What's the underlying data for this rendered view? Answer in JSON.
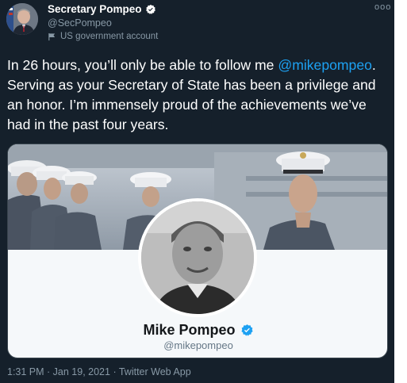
{
  "author": {
    "display_name": "Secretary Pompeo",
    "handle": "@SecPompeo",
    "label": "US government account",
    "verified": true,
    "avatar_icon": "portrait-avatar"
  },
  "menu": {
    "more_label": "ooo"
  },
  "tweet": {
    "text_before": "In 26 hours, you’ll only be able to follow me ",
    "mention": "@mikepompeo",
    "text_after": ". Serving as your Secretary of State has been a privilege and an honor. I’m immensely proud of the achievements we’ve had in the past four years."
  },
  "profile_card": {
    "name": "Mike Pompeo",
    "handle": "@mikepompeo",
    "verified": true
  },
  "meta": {
    "time": "1:31 PM",
    "separator1": " · ",
    "date": "Jan 19, 2021",
    "separator2": " · ",
    "app": "Twitter Web App"
  },
  "colors": {
    "background": "#15202b",
    "accent": "#1da1f2",
    "muted_text": "#8899a6",
    "card_background": "#f5f8fa"
  }
}
